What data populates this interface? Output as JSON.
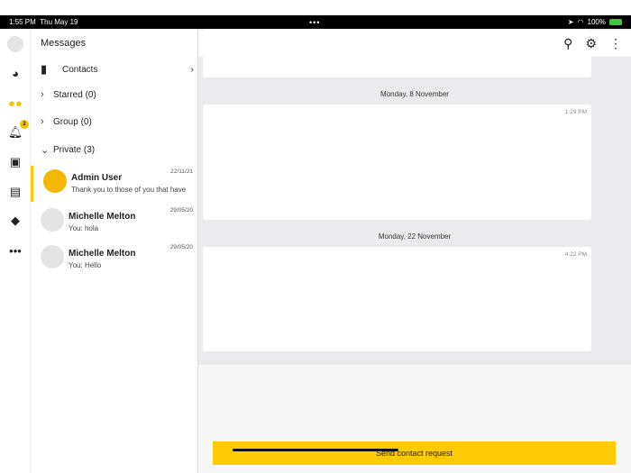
{
  "status_bar": {
    "time": "1:55 PM",
    "date": "Thu May 19",
    "battery": "100%"
  },
  "sidebar": {
    "notification_count": "2"
  },
  "messages": {
    "title": "Messages",
    "contacts_label": "Contacts",
    "groups": [
      {
        "label": "Starred (0)"
      },
      {
        "label": "Group (0)"
      },
      {
        "label": "Private (3)"
      }
    ],
    "conversations": [
      {
        "name": "Admin User",
        "preview": "Thank you to those of you that have",
        "date": "22/11/21"
      },
      {
        "name": "Michelle Melton",
        "preview": "You: hola",
        "date": "29/05/20"
      },
      {
        "name": "Michelle Melton",
        "preview": "You: Hello",
        "date": "29/05/20"
      }
    ]
  },
  "chat": {
    "days": [
      {
        "label": "Monday, 8 November",
        "time": "1:29 PM"
      },
      {
        "label": "Monday, 22 November",
        "time": "4:22 PM"
      }
    ],
    "send_label": "Send contact request"
  },
  "colors": {
    "accent": "#ffcb05"
  }
}
